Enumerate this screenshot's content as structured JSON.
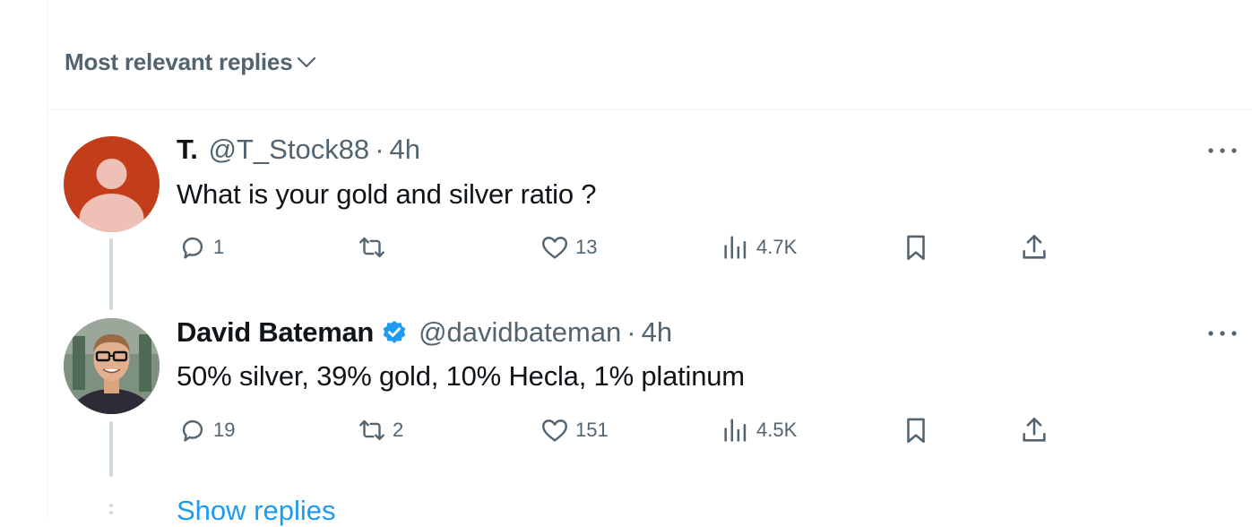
{
  "sort": {
    "label": "Most relevant replies",
    "icon": "chevron-down-icon"
  },
  "replies": [
    {
      "name": "T.",
      "handle": "@T_Stock88",
      "separator": "·",
      "time": "4h",
      "text": "What is your gold and silver ratio ?",
      "verified": false,
      "actions": {
        "reply": "1",
        "repost": "",
        "like": "13",
        "views": "4.7K"
      }
    },
    {
      "name": "David Bateman",
      "handle": "@davidbateman",
      "separator": "·",
      "time": "4h",
      "text": "50% silver, 39% gold, 10% Hecla, 1% platinum",
      "verified": true,
      "actions": {
        "reply": "19",
        "repost": "2",
        "like": "151",
        "views": "4.5K"
      }
    }
  ],
  "show_replies": "Show replies",
  "colors": {
    "accent": "#1d9bf0",
    "secondary_text": "#536471",
    "default_avatar_bg": "#c43d1a",
    "default_avatar_fg": "#efc1b6"
  }
}
